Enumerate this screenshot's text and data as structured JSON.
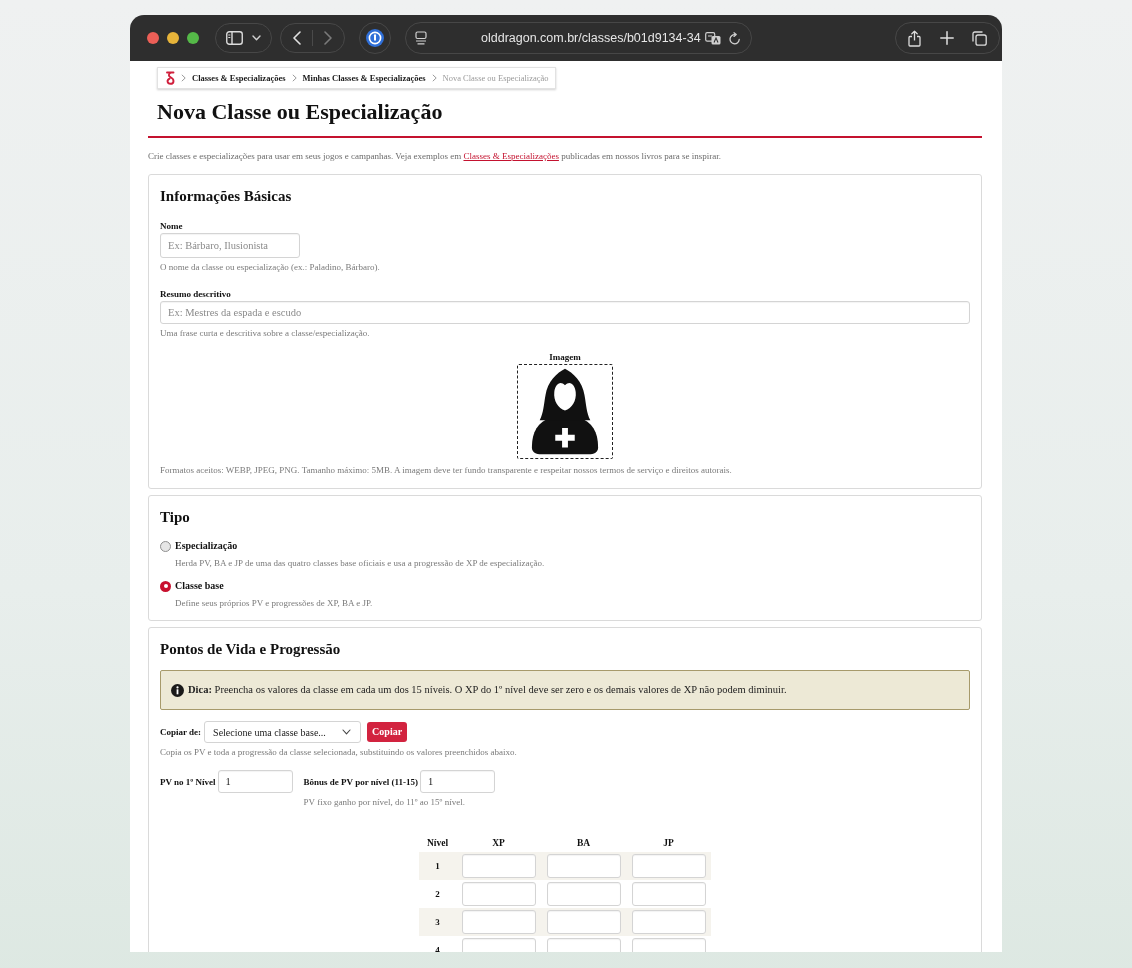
{
  "browser": {
    "url": "olddragon.com.br/classes/b01d9134-34"
  },
  "breadcrumb": [
    {
      "label": "Classes & Especializações",
      "current": false
    },
    {
      "label": "Minhas Classes & Especializações",
      "current": false
    },
    {
      "label": "Nova Classe ou Especialização",
      "current": true
    }
  ],
  "header": {
    "title": "Nova Classe ou Especialização",
    "intro": {
      "before": "Crie classes e especializações para usar em seus jogos e campanhas. Veja exemplos em",
      "link": "Classes & Especializações",
      "after": "publicadas em nossos livros para se inspirar."
    }
  },
  "basic_info": {
    "title": "Informações Básicas",
    "fields": [
      {
        "label": "Nome",
        "placeholder": "Ex: Bárbaro, Ilusionista",
        "help": "O nome da classe ou especialização (ex.: Paladino, Bárbaro)."
      },
      {
        "label": "Resumo descritivo",
        "placeholder": "Ex: Mestres da espada e escudo",
        "help": "Uma frase curta e descritiva sobre a classe/especialização."
      }
    ],
    "image": {
      "label": "Imagem",
      "help": "Formatos aceitos: WEBP, JPEG, PNG. Tamanho máximo: 5MB. A imagem deve ter fundo transparente e respeitar nossos termos de serviço e direitos autorais."
    }
  },
  "type": {
    "title": "Tipo",
    "options": [
      {
        "label": "Especialização",
        "description": "Herda PV, BA e JP de uma das quatro classes base oficiais e usa a progressão de XP de especialização.",
        "selected": false
      },
      {
        "label": "Classe base",
        "description": "Define seus próprios PV e progressões de XP, BA e JP.",
        "selected": true
      }
    ]
  },
  "progression": {
    "title": "Pontos de Vida e Progressão",
    "tip": "**Dica:** Preencha os valores da classe em cada um dos 15 níveis. O XP do 1º nível deve ser zero e os demais valores de XP não podem diminuir.",
    "copy": {
      "label": "Copiar de:",
      "value": "Selecione uma classe base...",
      "button": "Copiar",
      "help": "Copia os PV e toda a progressão da classe selecionada, substituindo os valores preenchidos abaixo."
    },
    "hp_fields": [
      {
        "label": "PV no 1º Nível",
        "value": "1"
      },
      {
        "label": "Bônus de PV por nível (11-15)",
        "value": "1",
        "help": "PV fixo ganho por nível, do 11º ao 15º nível."
      }
    ],
    "table": {
      "columns": [
        "Nível",
        "XP",
        "BA",
        "JP"
      ],
      "rows": [
        {
          "level": "1"
        },
        {
          "level": "2"
        },
        {
          "level": "3"
        },
        {
          "level": "4"
        }
      ]
    }
  }
}
